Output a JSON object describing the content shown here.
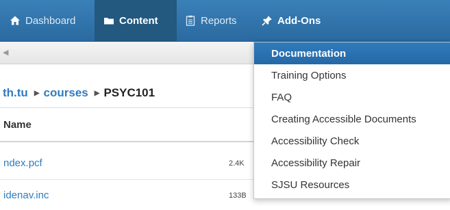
{
  "navbar": {
    "items": [
      {
        "label": "Dashboard",
        "icon": "home-icon"
      },
      {
        "label": "Content",
        "icon": "folder-icon"
      },
      {
        "label": "Reports",
        "icon": "clipboard-icon"
      },
      {
        "label": "Add-Ons",
        "icon": "pin-icon"
      }
    ],
    "active": "Content",
    "colors": {
      "bar": "#2f74ad",
      "active": "#23587f"
    }
  },
  "breadcrumb": {
    "items": [
      "th.tu",
      "courses"
    ],
    "current": "PSYC101"
  },
  "table": {
    "columns": [
      "Name"
    ],
    "rows": [
      {
        "name": "ndex.pcf",
        "size": "2.4K"
      },
      {
        "name": "idenav.inc",
        "size": "133B"
      }
    ]
  },
  "addons_menu": {
    "items": [
      "Documentation",
      "Training Options",
      "FAQ",
      "Creating Accessible Documents",
      "Accessibility Check",
      "Accessibility Repair",
      "SJSU Resources"
    ],
    "highlighted": "Documentation",
    "highlight_color": "#2a70b0"
  }
}
